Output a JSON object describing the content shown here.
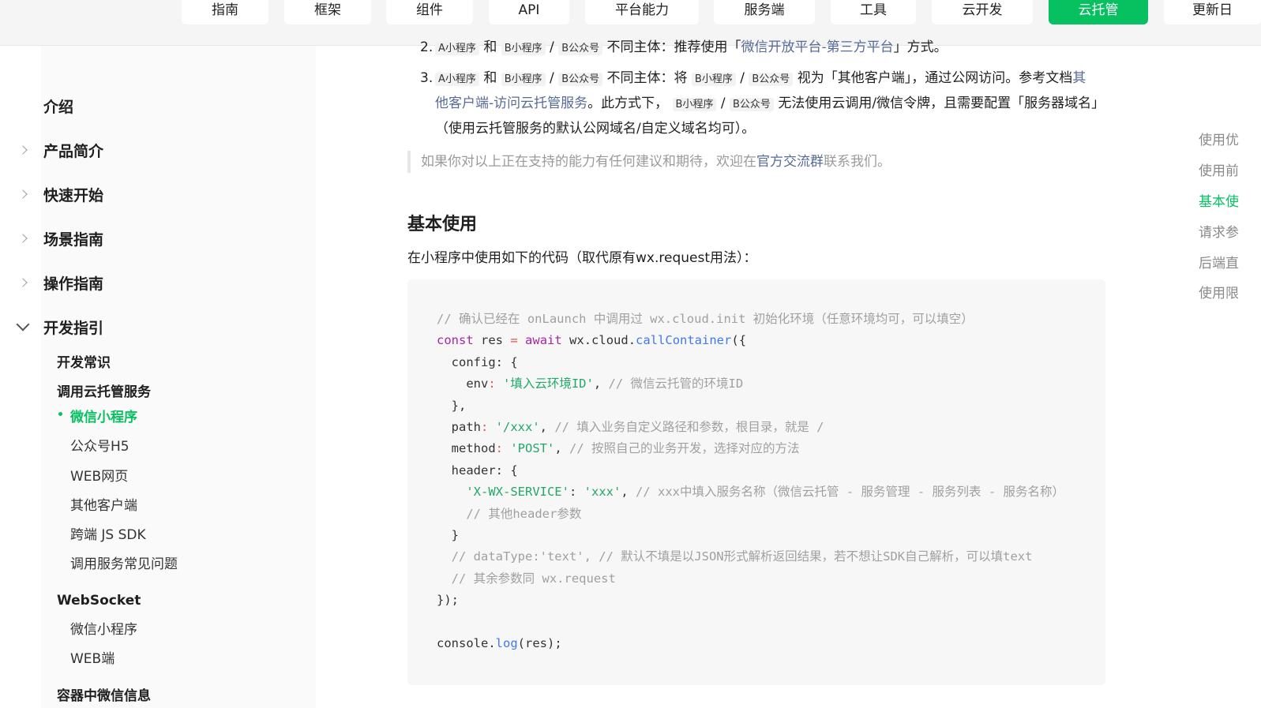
{
  "nav": {
    "items": [
      {
        "label": "指南"
      },
      {
        "label": "框架"
      },
      {
        "label": "组件"
      },
      {
        "label": "API"
      },
      {
        "label": "平台能力"
      },
      {
        "label": "服务端"
      },
      {
        "label": "工具"
      },
      {
        "label": "云开发"
      },
      {
        "label": "云托管"
      },
      {
        "label": "更新日"
      }
    ],
    "active": "云托管",
    "accent": "#07c160"
  },
  "sidebar": {
    "top_items": [
      "介绍",
      "产品简介",
      "快速开始",
      "场景指南",
      "操作指南",
      "开发指引"
    ],
    "section1": "开发常识",
    "section2": "调用云托管服务",
    "call_items": [
      "微信小程序",
      "公众号H5",
      "WEB网页",
      "其他客户端",
      "跨端 JS SDK",
      "调用服务常见问题"
    ],
    "section3": "WebSocket",
    "ws_items": [
      "微信小程序",
      "WEB端"
    ],
    "section4": "容器中微信信息"
  },
  "content": {
    "item2": {
      "num": "2.",
      "tag_a": "A小程序",
      "and": "和",
      "tag_b": "B小程序",
      "slash": "/",
      "tag_c": "B公众号",
      "text": "不同主体：推荐使用「",
      "link": "微信开放平台-第三方平台",
      "tail": "」方式。"
    },
    "item3": {
      "num": "3.",
      "tag_a": "A小程序",
      "and": "和",
      "tag_b": "B小程序",
      "slash": "/",
      "tag_c": "B公众号",
      "t1": "不同主体：将",
      "tag_d": "B小程序",
      "tag_e": "B公众号",
      "t2": "视为「其他客户端」，通过公网访问。参考文档",
      "link": "其他客户端-访问云托管服务",
      "t3": "。此方式下，",
      "tag_f": "B小程序",
      "tag_g": "B公众号",
      "t4": "无法使用云调用/微信令牌，且需要配置「服务器域名」（使用云托管服务的默认公网域名/自定义域名均可）。"
    },
    "quote": {
      "pre": "如果你对以上正在支持的能力有任何建议和期待，欢迎在",
      "link": "官方交流群",
      "post": "联系我们。"
    },
    "heading": "基本使用",
    "intro": "在小程序中使用如下的代码（取代原有wx.request用法）：",
    "code": {
      "l1": "// 确认已经在 onLaunch 中调用过 wx.cloud.init 初始化环境（任意环境均可，可以填空）",
      "l2_kw": "const",
      "l2_var": " res ",
      "l2_eq": "=",
      "l2_kw2": "await",
      "l2_obj": " wx.cloud.",
      "l2_fn": "callContainer",
      "l2_end": "({",
      "l3": "  config",
      "l3_end": ": {",
      "l4_key": "    env",
      "l4_colon": ": ",
      "l4_str": "'填入云环境ID'",
      "l4_comma": ", ",
      "l4_cm": "// 微信云托管的环境ID",
      "l5": "  },",
      "l6_key": "  path",
      "l6_str": "'/xxx'",
      "l6_cm": "// 填入业务自定义路径和参数，根目录，就是 /",
      "l7_key": "  method",
      "l7_str": "'POST'",
      "l7_cm": "// 按照自己的业务开发，选择对应的方法",
      "l8_key": "  header",
      "l8_end": ": {",
      "l9_str1": "    'X-WX-SERVICE'",
      "l9_str2": "'xxx'",
      "l9_cm": "// xxx中填入服务名称（微信云托管 - 服务管理 - 服务列表 - 服务名称）",
      "l10": "    // 其他header参数",
      "l11": "  }",
      "l12": "  // dataType:'text', // 默认不填是以JSON形式解析返回结果，若不想让SDK自己解析，可以填text",
      "l13": "  // 其余参数同 wx.request",
      "l14": "});",
      "l16_obj": "console.",
      "l16_fn": "log",
      "l16_end": "(res);"
    }
  },
  "toc": {
    "items": [
      "使用优",
      "使用前",
      "基本使",
      "请求参",
      "后端直",
      "使用限"
    ],
    "active": "基本使"
  }
}
